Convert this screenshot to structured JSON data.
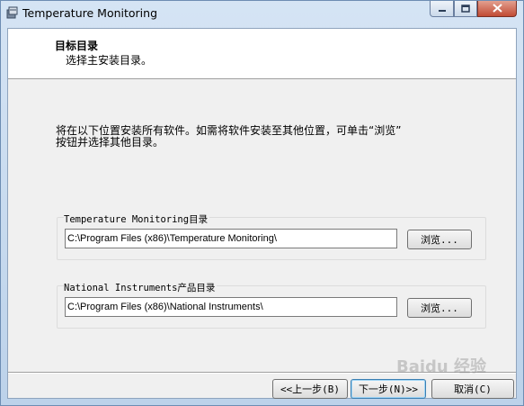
{
  "window": {
    "title": "Temperature Monitoring"
  },
  "header": {
    "title": "目标目录",
    "subtitle": "选择主安装目录。"
  },
  "main": {
    "description": "将在以下位置安装所有软件。如需将软件安装至其他位置，可单击“浏览”\n按钮并选择其他目录。",
    "groups": [
      {
        "label": "Temperature Monitoring目录",
        "path": "C:\\Program Files (x86)\\Temperature Monitoring\\",
        "browse_label": "浏览..."
      },
      {
        "label": "National Instruments产品目录",
        "path": "C:\\Program Files (x86)\\National Instruments\\",
        "browse_label": "浏览..."
      }
    ]
  },
  "footer": {
    "back_label": "<<上一步(B)",
    "next_label": "下一步(N)>>",
    "cancel_label": "取消(C)"
  },
  "watermark": "Baidu 经验",
  "icons": {
    "app": "installer-icon",
    "minimize": "minimize-icon",
    "maximize": "maximize-icon",
    "close": "close-icon"
  }
}
